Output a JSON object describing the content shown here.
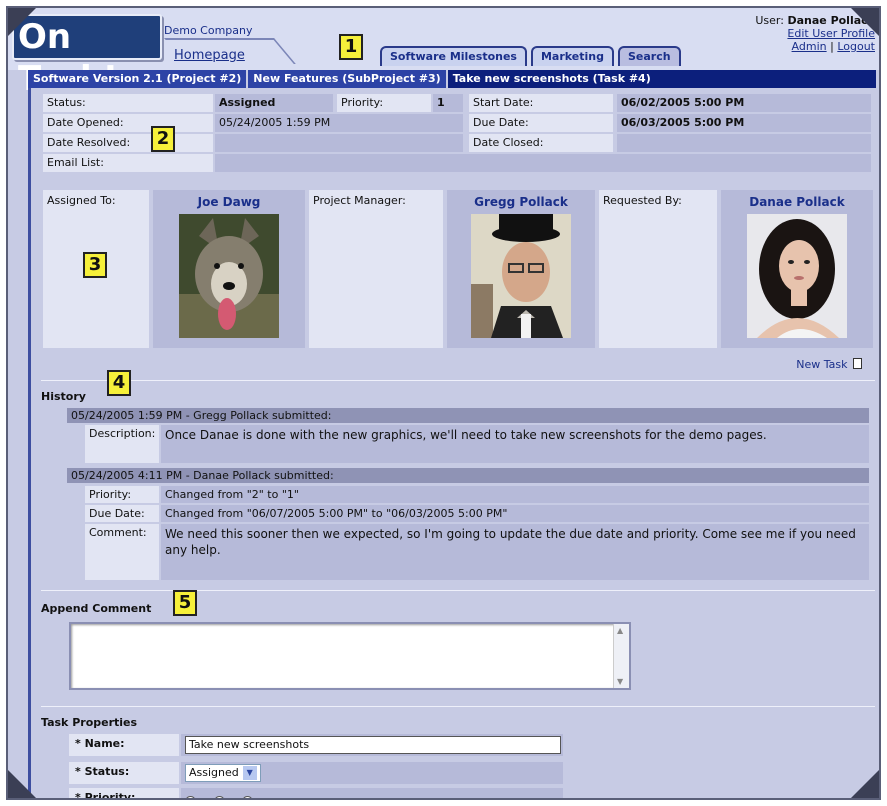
{
  "header": {
    "logo": "On Task!",
    "company": "Demo Company",
    "homepage": "Homepage",
    "user_label": "User:",
    "user_name": "Danae Pollack",
    "edit_profile": "Edit User Profile",
    "admin": "Admin",
    "separator": "|",
    "logout": "Logout"
  },
  "tabs": [
    "Software Milestones",
    "Marketing",
    "Search"
  ],
  "callouts": [
    "1",
    "2",
    "3",
    "4",
    "5"
  ],
  "breadcrumb": [
    "Software Version 2.1 (Project #2)",
    "New Features (SubProject #3)",
    "Take new screenshots (Task #4)"
  ],
  "details": {
    "status_label": "Status:",
    "status": "Assigned",
    "priority_label": "Priority:",
    "priority": "1",
    "start_label": "Start Date:",
    "start": "06/02/2005 5:00 PM",
    "opened_label": "Date Opened:",
    "opened": "05/24/2005 1:59 PM",
    "due_label": "Due Date:",
    "due": "06/03/2005 5:00 PM",
    "resolved_label": "Date Resolved:",
    "closed_label": "Date Closed:",
    "email_label": "Email List:"
  },
  "people": {
    "assigned_label": "Assigned To:",
    "assigned": "Joe Dawg",
    "pm_label": "Project Manager:",
    "pm": "Gregg Pollack",
    "requested_label": "Requested By:",
    "requested": "Danae Pollack"
  },
  "new_task": "New Task",
  "history": {
    "title": "History",
    "entries": [
      {
        "header": "05/24/2005 1:59 PM - Gregg Pollack submitted:",
        "desc_label": "Description:",
        "desc": "Once Danae is done with the new graphics, we'll need to take new screenshots for the demo pages."
      },
      {
        "header": "05/24/2005 4:11 PM - Danae Pollack submitted:",
        "priority_label": "Priority:",
        "priority": "Changed from \"2\" to \"1\"",
        "due_label": "Due Date:",
        "due": "Changed from \"06/07/2005 5:00 PM\" to \"06/03/2005 5:00 PM\"",
        "comment_label": "Comment:",
        "comment": "We need this sooner then we expected, so I'm going to update the due date and priority.  Come see me if you need any help."
      }
    ]
  },
  "append": {
    "title": "Append Comment",
    "value": ""
  },
  "props": {
    "title": "Task Properties",
    "name_label": "* Name:",
    "name": "Take new screenshots",
    "status_label": "* Status:",
    "status": "Assigned",
    "priority_label": "* Priority:"
  },
  "colors": {
    "nav_dark": "#0c1f7c",
    "panel": "#c7cbe4",
    "callout": "#f6f03a"
  }
}
